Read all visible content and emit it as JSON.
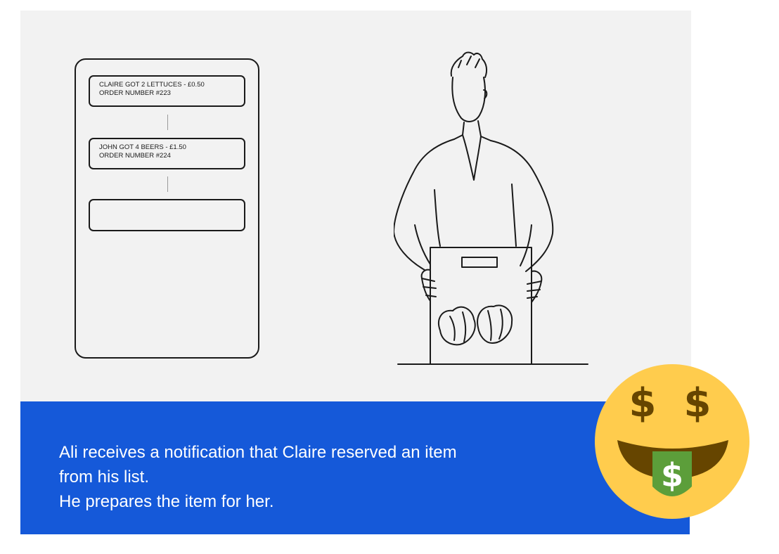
{
  "notifications": [
    {
      "line1": "CLAIRE GOT 2 LETTUCES - £0.50",
      "line2": "ORDER NUMBER #223"
    },
    {
      "line1": "JOHN GOT 4  BEERS - £1.50",
      "line2": "ORDER NUMBER #224"
    },
    {
      "line1": "",
      "line2": ""
    }
  ],
  "caption": {
    "line1": "Ali receives a notification that Claire reserved an item",
    "line2": "from his list.",
    "line3": "He prepares the item for her."
  },
  "colors": {
    "panel_background": "#f2f2f2",
    "caption_background": "#1559d9",
    "emoji_face": "#ffcc4d",
    "emoji_tongue": "#5c9e3a"
  },
  "icons": {
    "illustration": "man-holding-box-of-lettuces",
    "emoji": "money-mouth-face-emoji"
  }
}
